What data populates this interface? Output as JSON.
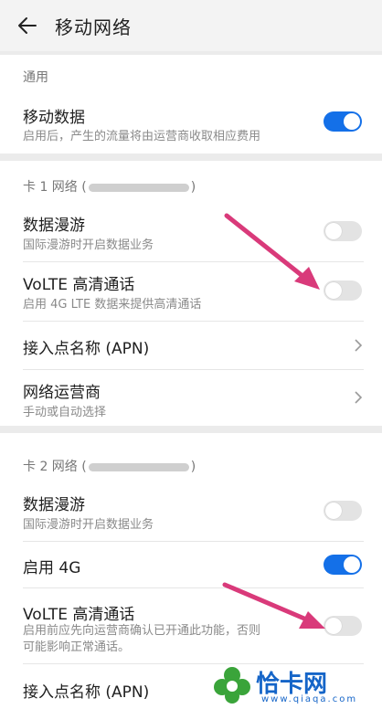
{
  "header": {
    "title": "移动网络"
  },
  "general": {
    "label": "通用",
    "mobile_data": {
      "title": "移动数据",
      "subtitle": "启用后，产生的流量将由运营商收取相应费用",
      "enabled": true
    }
  },
  "sim1": {
    "label_prefix": "卡 1 网络 (",
    "label_suffix": ")",
    "roaming": {
      "title": "数据漫游",
      "subtitle": "国际漫游时开启数据业务",
      "enabled": false
    },
    "volte": {
      "title": "VoLTE 高清通话",
      "subtitle": "启用 4G LTE 数据来提供高清通话",
      "enabled": false
    },
    "apn": {
      "title": "接入点名称 (APN)"
    },
    "carrier": {
      "title": "网络运营商",
      "subtitle": "手动或自动选择"
    }
  },
  "sim2": {
    "label_prefix": "卡 2 网络 (",
    "label_suffix": ")",
    "roaming": {
      "title": "数据漫游",
      "subtitle": "国际漫游时开启数据业务",
      "enabled": false
    },
    "enable_4g": {
      "title": "启用 4G",
      "enabled": true
    },
    "volte": {
      "title": "VoLTE 高清通话",
      "subtitle_line1": "启用前应先向运营商确认已开通此功能，否则",
      "subtitle_line2": "可能影响正常通话。",
      "enabled": false
    },
    "apn": {
      "title": "接入点名称 (APN)"
    }
  },
  "watermark": {
    "brand": "恰卡网",
    "url": "www.qiaqa.com"
  },
  "colors": {
    "accent": "#1470e8",
    "annotation_arrow": "#d93a7a"
  }
}
